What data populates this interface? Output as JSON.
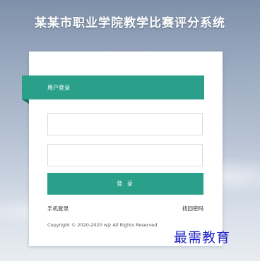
{
  "header": {
    "title": "某某市职业学院教学比赛评分系统"
  },
  "login_card": {
    "heading": "用户登录",
    "username": {
      "value": "",
      "placeholder": ""
    },
    "password": {
      "value": "",
      "placeholder": ""
    },
    "submit_label": "登 录",
    "phone_login_label": "手机登录",
    "forgot_password_label": "找回密码",
    "copyright": "Copyright © 2020-2020 wjz All Rights Reserved"
  },
  "watermark": {
    "text": "最需教育"
  },
  "colors": {
    "accent": "#2aa08b",
    "accent_dark": "#1c6e60",
    "watermark": "#1a1ec9"
  }
}
